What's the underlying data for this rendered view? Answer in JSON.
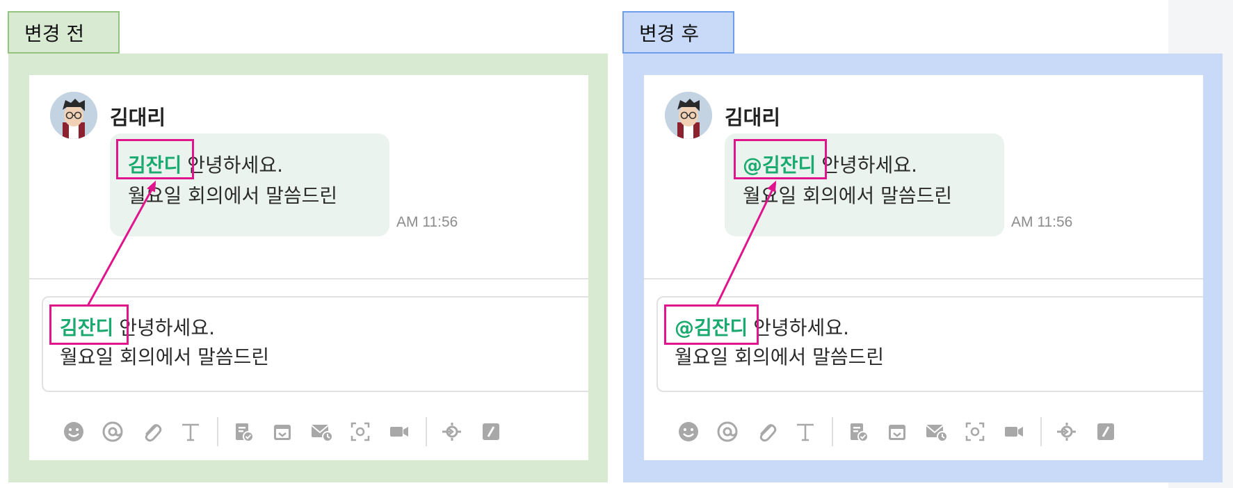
{
  "panels": {
    "before": {
      "tag": "변경 전",
      "sender": "김대리",
      "message": {
        "mention": "김잔디",
        "text_line1": "안녕하세요.",
        "text_line2": "월요일 회의에서 말씀드린",
        "time": "AM 11:56"
      },
      "composer": {
        "mention": "김잔디",
        "text_line1": "안녕하세요.",
        "text_line2": "월요일 회의에서 말씀드린"
      }
    },
    "after": {
      "tag": "변경 후",
      "sender": "김대리",
      "message": {
        "mention": "@김잔디",
        "text_line1": "안녕하세요.",
        "text_line2": "월요일 회의에서 말씀드린",
        "time": "AM 11:56"
      },
      "composer": {
        "mention": "@김잔디",
        "text_line1": "안녕하세요.",
        "text_line2": "월요일 회의에서 말씀드린"
      }
    }
  },
  "toolbar_icons": [
    "emoji-icon",
    "mention-icon",
    "attachment-icon",
    "text-format-icon",
    "todo-icon",
    "archive-icon",
    "mail-schedule-icon",
    "screenshot-icon",
    "video-icon",
    "share-icon",
    "slash-command-icon"
  ],
  "colors": {
    "before_bg": "#d9ead3",
    "after_bg": "#c9daf8",
    "mention": "#1aaa6f",
    "highlight": "#e0148c",
    "bubble": "#eaf3ee",
    "icon": "#a8a8a8"
  }
}
